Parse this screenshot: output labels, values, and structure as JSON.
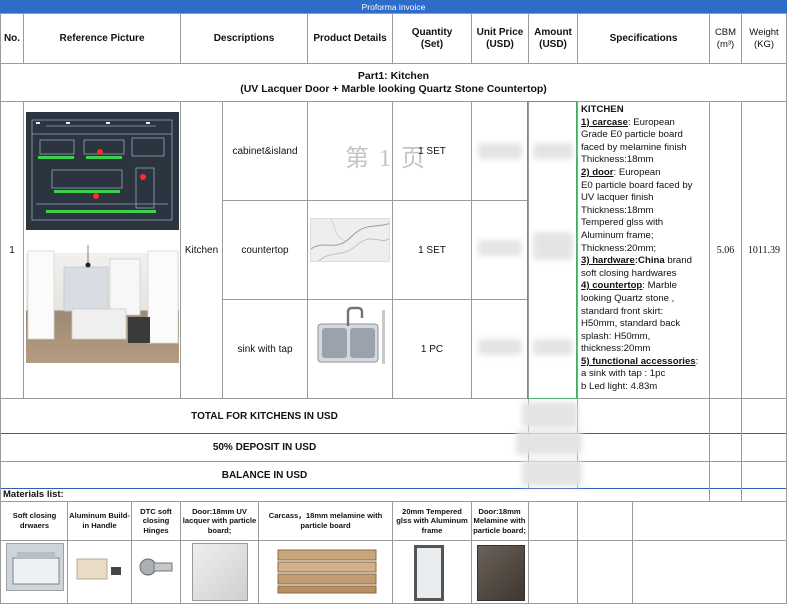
{
  "title": "Proforma invoice",
  "columns": {
    "no": "No.",
    "ref": "Reference Picture",
    "desc": "Descriptions",
    "details": "Product Details",
    "qty_1": "Quantity",
    "qty_2": "(Set)",
    "price_1": "Unit Price",
    "price_2": "(USD)",
    "amount_1": "Amount",
    "amount_2": "(USD)",
    "spec": "Specifications",
    "cbm_1": "CBM",
    "cbm_2": "(m³)",
    "weight_1": "Weight",
    "weight_2": "(KG)"
  },
  "part": {
    "line1": "Part1: Kitchen",
    "line2": "(UV Lacquer  Door +  Marble looking Quartz Stone Countertop)"
  },
  "row": {
    "no": "1",
    "description": "Kitchen",
    "items": [
      {
        "name": "cabinet&island",
        "qty": "1 SET"
      },
      {
        "name": "countertop",
        "qty": "1 SET"
      },
      {
        "name": "sink with tap",
        "qty": "1 PC"
      }
    ],
    "watermark": "第 1 页",
    "cbm": "5.06",
    "weight": "1011.39"
  },
  "specs": {
    "heading": "KITCHEN",
    "s1_label": "1) carcase",
    "s1_l1": ":  European",
    "s1_l2": "Grade E0 particle board",
    "s1_l3": "faced by melamine finish",
    "s1_l4": "Thickness:18mm",
    "s2_label": "2) door",
    "s2_l1": ":  European",
    "s2_l2": "Grade",
    "s2_l2b": "E0 particle board faced by",
    "s2_l3": "UV lacquer finish",
    "s2_l4": "Thickness:18mm",
    "s2_l5": "Tempered glss with",
    "s2_l6": "Aluminum frame;",
    "s2_l7": "Thickness:20mm;",
    "s3_label": "3) hardware",
    "s3_bold": ":China",
    "s3_l1": " brand",
    "s3_l2": "soft closing hardwares",
    "s4_label": "4) countertop",
    "s4_l1": ":  Marble",
    "s4_l2": "looking Quartz stone ,",
    "s4_l3": "standard front skirt:",
    "s4_l4": "H50mm, standard back",
    "s4_l5": "splash: H50mm,",
    "s4_l6": "thickness:20mm",
    "s5_label": "5) functional accessories",
    "s5_l1": ":",
    "s5_l2": "a sink with tap : 1pc",
    "s5_l3": "b Led light: 4.83m"
  },
  "totals": {
    "total": "TOTAL FOR KITCHENS IN USD",
    "deposit": "50% DEPOSIT  IN USD",
    "balance": "BALANCE  IN USD"
  },
  "materials": {
    "label": "Materials list:",
    "items": [
      "Soft closing drwaers",
      "Aluminum Build-in Handle",
      "DTC soft closing Hinges",
      "Door:18mm UV lacquer with particle board;",
      "Carcass，18mm melamine with particle board",
      "20mm Tempered glss with Aluminum frame",
      "Door:18mm Melamine with particle board;"
    ]
  },
  "icons": {
    "plan": "kitchen-plan-image",
    "photo": "kitchen-photo-image",
    "marble": "marble-sample-image",
    "sink": "sink-with-tap-image"
  }
}
